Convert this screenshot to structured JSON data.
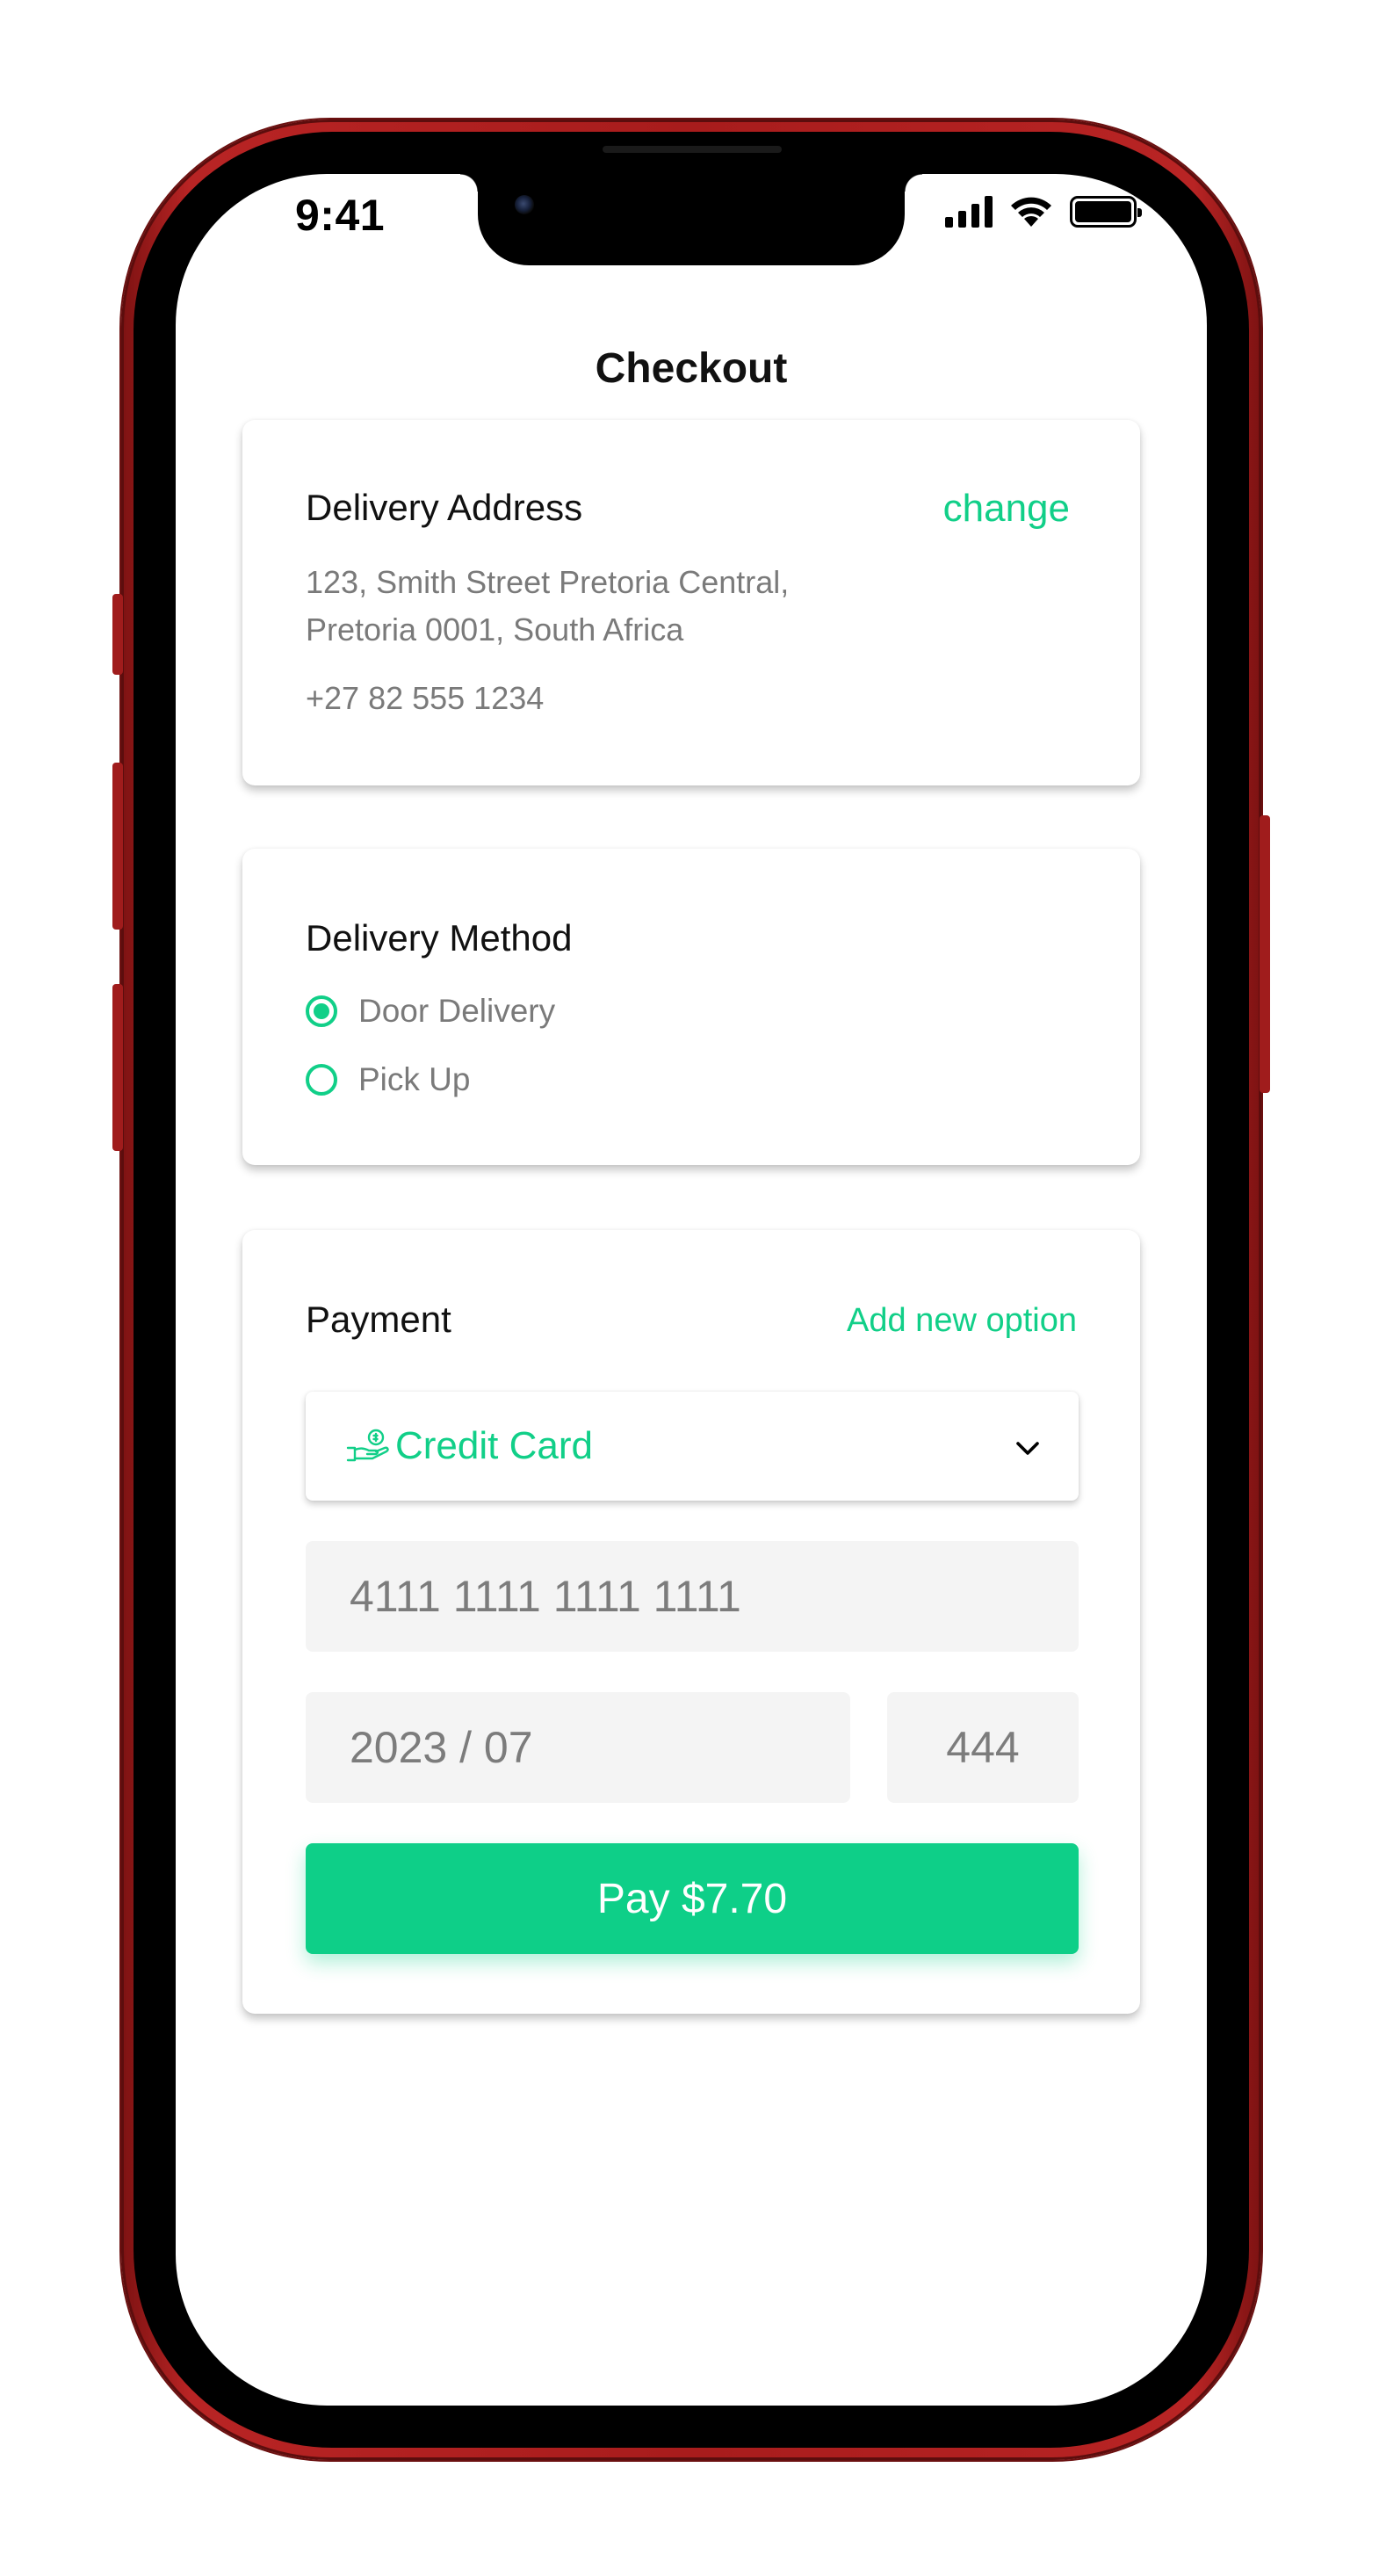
{
  "status_bar": {
    "time": "9:41"
  },
  "page": {
    "title": "Checkout"
  },
  "delivery_address": {
    "heading": "Delivery Address",
    "change_link": "change",
    "address_line1": "123, Smith Street Pretoria Central,",
    "address_line2": "Pretoria 0001, South Africa",
    "phone": "+27 82 555 1234"
  },
  "delivery_method": {
    "heading": "Delivery Method",
    "options": [
      {
        "label": "Door Delivery",
        "selected": true
      },
      {
        "label": "Pick Up",
        "selected": false
      }
    ]
  },
  "payment": {
    "heading": "Payment",
    "add_option_link": "Add new option",
    "selected_method": "Credit Card",
    "method_icon": "hand-coin-icon",
    "card_number": "4111 1111 1111 1111",
    "expiry": "2023 / 07",
    "cvv": "444",
    "pay_button": "Pay $7.70"
  },
  "colors": {
    "accent": "#0ecf88",
    "phone_frame": "#a81c1c",
    "field_bg": "#f4f4f4",
    "muted_text": "#7a7a7a"
  }
}
